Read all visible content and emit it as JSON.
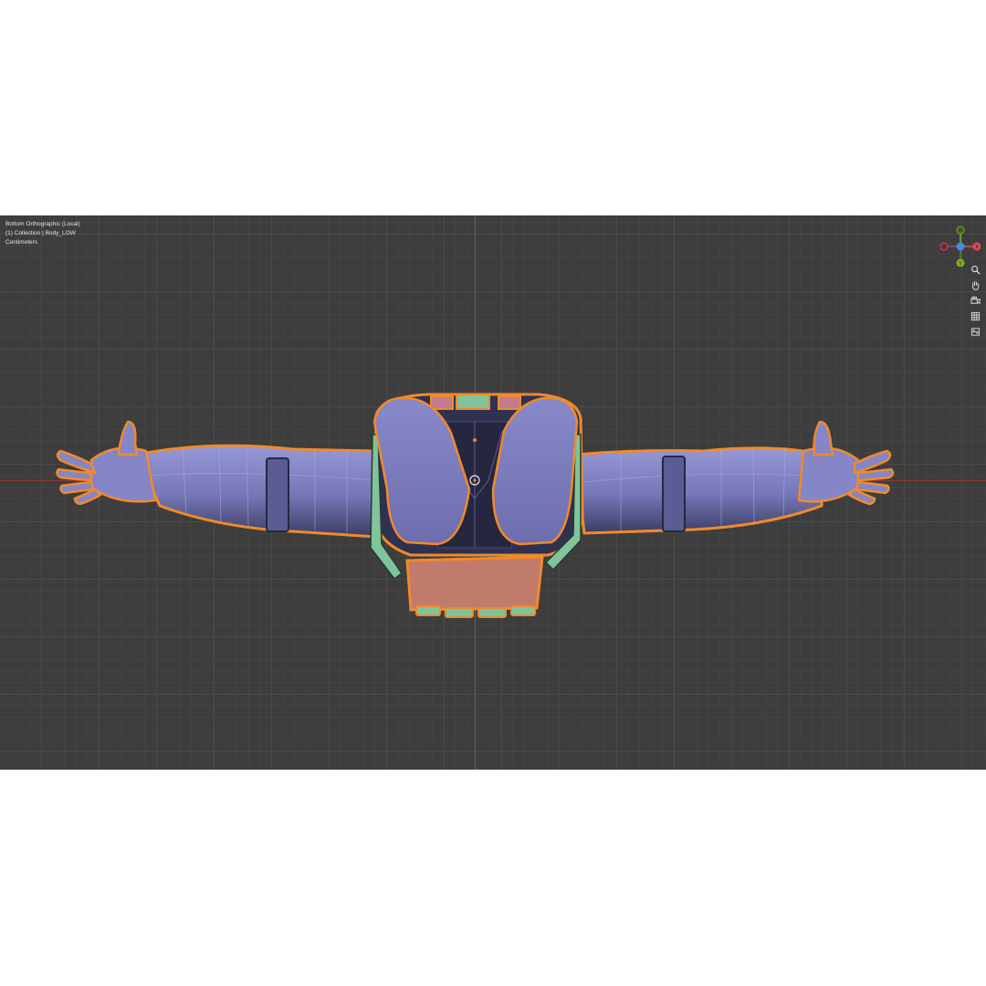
{
  "viewport": {
    "view_name": "Bottom Orthographic (Local)",
    "collection_line": "(1) Collection | Body_LOW",
    "units": "Centimeters"
  },
  "gizmo": {
    "axes": {
      "x": "X",
      "y": "Y",
      "z": "Z"
    },
    "colors": {
      "x": "#e24b5b",
      "y": "#7fb02a",
      "z": "#3e8ee0"
    }
  },
  "navigation_tools": [
    "zoom-icon",
    "pan-hand-icon",
    "camera-icon",
    "grid-icon",
    "ortho-toggle-icon"
  ],
  "colors": {
    "background": "#3d3d3d",
    "mesh_body": "#7d7fbf",
    "mesh_dark": "#2f3150",
    "selection_outline": "#f08a2c",
    "straps": "#7fc49a",
    "pouch": "#c07b6c"
  }
}
